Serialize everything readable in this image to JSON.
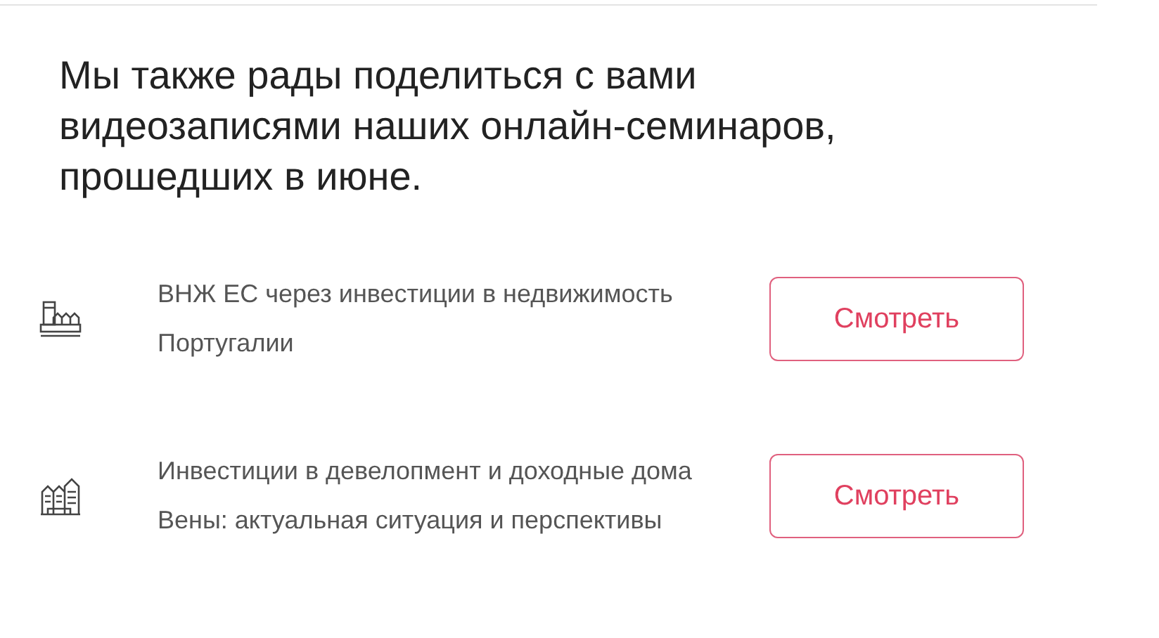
{
  "heading": "Мы также рады поделиться с вами видеозаписями наших онлайн-семинаров, прошедших в июне.",
  "webinars": [
    {
      "title_lines": [
        "ВНЖ ЕС через инвестиции в недвижимость",
        "Португалии"
      ],
      "button": "Смотреть"
    },
    {
      "title_lines": [
        "Инвестиции в девелопмент и доходные дома",
        "Вены: актуальная ситуация и перспективы"
      ],
      "button": "Смотреть"
    }
  ]
}
